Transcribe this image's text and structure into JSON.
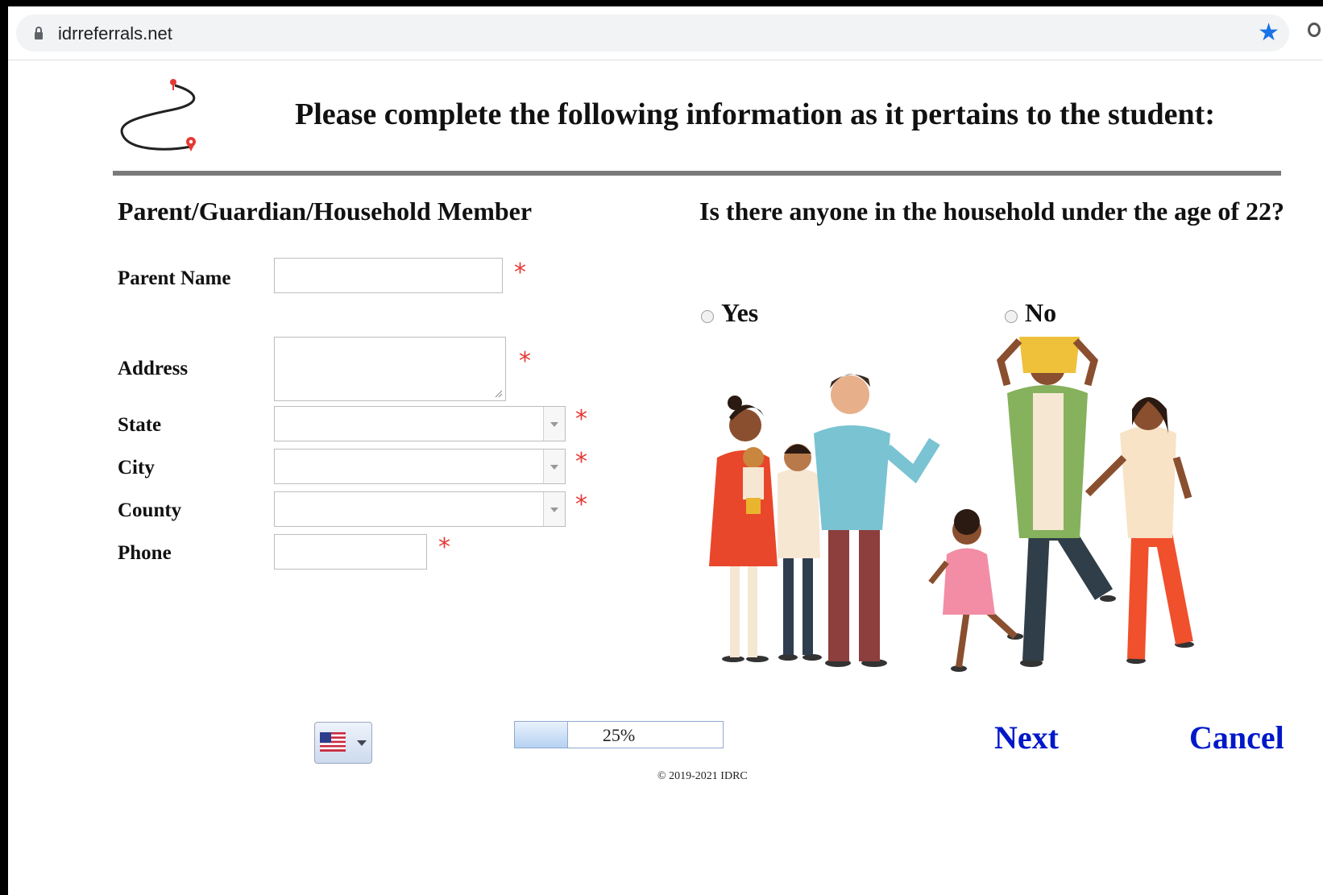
{
  "browser": {
    "url": "idrreferrals.net",
    "bookmark_icon": "star-icon",
    "lock_icon": "lock-icon",
    "extension_icon": "circle-extension-icon"
  },
  "page": {
    "heading": "Please complete the following information as it pertains to the student:",
    "logo_icon": "route-logo-icon"
  },
  "form": {
    "section_title": "Parent/Guardian/Household Member",
    "required_mark": "*",
    "fields": {
      "parent_name": {
        "label": "Parent Name",
        "value": ""
      },
      "address": {
        "label": "Address",
        "value": ""
      },
      "state": {
        "label": "State",
        "value": ""
      },
      "city": {
        "label": "City",
        "value": ""
      },
      "county": {
        "label": "County",
        "value": ""
      },
      "phone": {
        "label": "Phone",
        "value": ""
      }
    }
  },
  "household_question": {
    "text": "Is there anyone in the household under the age of 22?",
    "options": [
      "Yes",
      "No"
    ],
    "illustration_icon": "family-illustration"
  },
  "footer": {
    "language_flag_icon": "us-flag-icon",
    "progress_percent": 25,
    "progress_text": "25%",
    "copyright": "© 2019-2021 IDRC",
    "next_label": "Next",
    "cancel_label": "Cancel"
  },
  "colors": {
    "link": "#0018c8",
    "required": "#e53935",
    "bookmark": "#1a73e8"
  }
}
